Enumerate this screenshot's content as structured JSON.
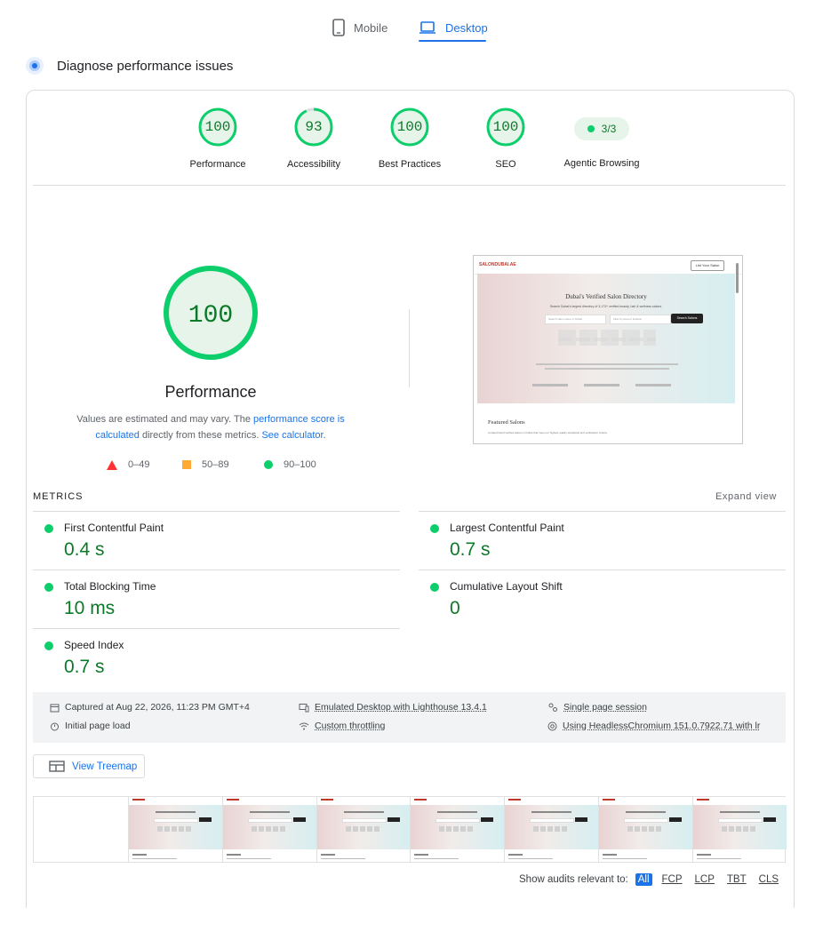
{
  "tabs": [
    {
      "label": "Mobile",
      "icon": "phone-icon",
      "active": false
    },
    {
      "label": "Desktop",
      "icon": "laptop-icon",
      "active": true
    }
  ],
  "section_title": "Diagnose performance issues",
  "category_scores": [
    {
      "label": "Performance",
      "score": "100"
    },
    {
      "label": "Accessibility",
      "score": "93"
    },
    {
      "label": "Best Practices",
      "score": "100"
    },
    {
      "label": "SEO",
      "score": "100"
    }
  ],
  "agentic": {
    "label": "Agentic Browsing",
    "value": "3/3"
  },
  "main_gauge": {
    "score": "100",
    "title": "Performance"
  },
  "description": {
    "prefix": "Values are estimated and may vary. The ",
    "link1": "performance score is calculated",
    "middle": " directly from these metrics. ",
    "link2": "See calculator",
    "suffix": "."
  },
  "legend": [
    {
      "range": "0–49",
      "color": "#ff3333"
    },
    {
      "range": "50–89",
      "color": "#ffaa33"
    },
    {
      "range": "90–100",
      "color": "#0cce6b"
    }
  ],
  "metrics_label": "METRICS",
  "expand_label": "Expand view",
  "metrics": [
    {
      "name": "First Contentful Paint",
      "value": "0.4 s"
    },
    {
      "name": "Largest Contentful Paint",
      "value": "0.7 s"
    },
    {
      "name": "Total Blocking Time",
      "value": "10 ms"
    },
    {
      "name": "Cumulative Layout Shift",
      "value": "0"
    },
    {
      "name": "Speed Index",
      "value": "0.7 s"
    }
  ],
  "info": {
    "captured": "Captured at Aug 22, 2026, 11:23 PM GMT+4",
    "load": "Initial page load",
    "emulated": "Emulated Desktop with Lighthouse 13.4.1",
    "throttling": "Custom throttling",
    "session": "Single page session",
    "browser": "Using HeadlessChromium 151.0.7922.71 with lr"
  },
  "treemap_label": "View Treemap",
  "screenshot": {
    "logo": "SALONDUBAI.AE",
    "nav_button": "List Your Salon",
    "headline": "Dubai's Verified Salon Directory",
    "subline": "Search Dubai's largest directory of 3,173+ verified beauty, hair & wellness salons.",
    "search_placeholder": "Search salon name or Dubai",
    "location_placeholder": "Filter by area or location",
    "search_button": "Search Salons",
    "featured": "Featured Salons",
    "featured_sub": "Curated listed verified salons in Dubai that meet our highest quality standards and verification criteria"
  },
  "audits": {
    "label": "Show audits relevant to:",
    "chips": [
      "All",
      "FCP",
      "LCP",
      "TBT",
      "CLS"
    ]
  },
  "colors": {
    "accent": "#1a73e8",
    "pass": "#0cce6b",
    "pass_text": "#0b7a28"
  }
}
